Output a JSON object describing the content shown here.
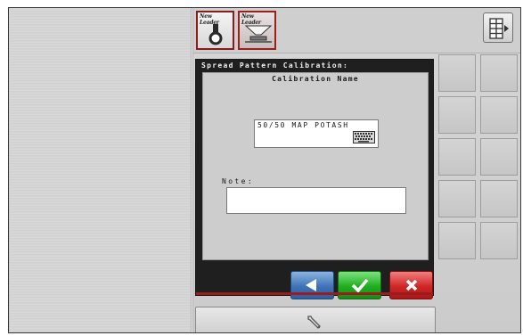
{
  "tabs": [
    {
      "brand": "New Leader",
      "icon": "tractor-mount-icon"
    },
    {
      "brand": "New Leader",
      "icon": "spreader-icon"
    }
  ],
  "menu_icon": "grid-menu-icon",
  "dialog": {
    "title": "Spread Pattern Calibration:",
    "name_label": "Calibration Name",
    "name_value": "50/50 MAP POTASH",
    "note_label": "Note:",
    "note_value": ""
  },
  "buttons": {
    "back_icon": "arrow-left-icon",
    "accept_icon": "checkmark-icon",
    "cancel_icon": "close-icon"
  },
  "bottom": {
    "icon": "wrench-icon"
  },
  "colors": {
    "back": "#3d73b7",
    "accept": "#1fae1f",
    "cancel": "#d02626",
    "accent": "#9a1c1c"
  }
}
